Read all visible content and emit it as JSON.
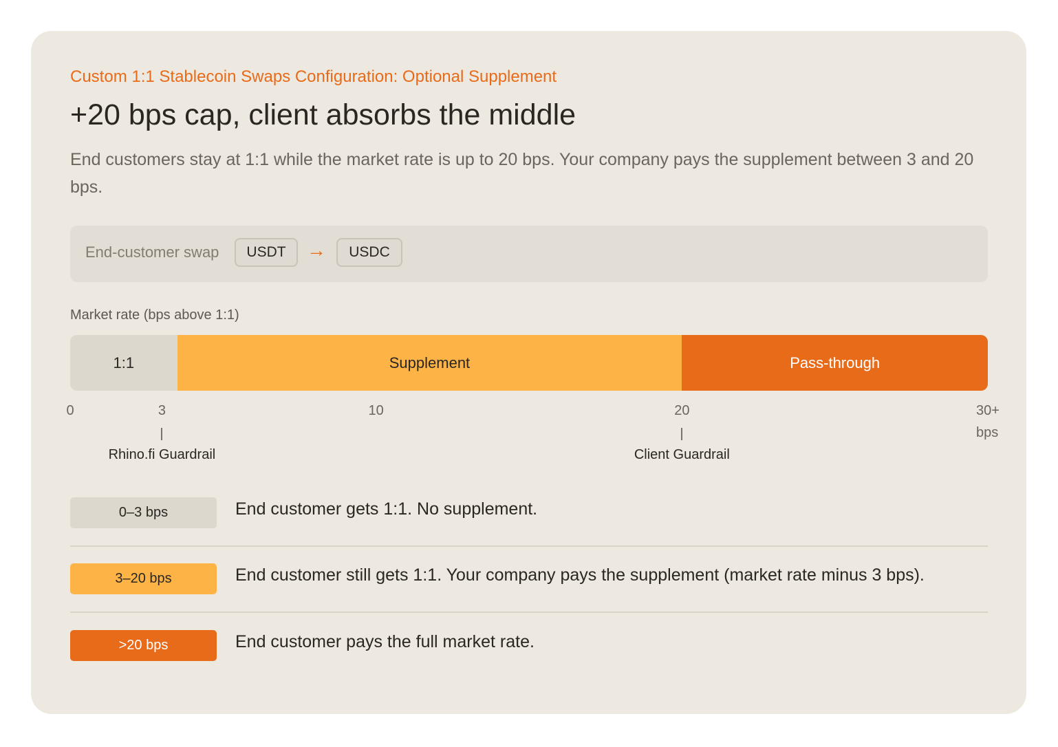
{
  "header": {
    "eyebrow": "Custom 1:1 Stablecoin Swaps Configuration: Optional Supplement",
    "title": "+20 bps cap, client absorbs the middle",
    "description": "End customers stay at 1:1 while the market rate is up to 20 bps. Your company pays the supplement between 3 and 20 bps."
  },
  "swap": {
    "label": "End-customer swap",
    "from_token": "USDT",
    "arrow": "→",
    "to_token": "USDC"
  },
  "chart_data": {
    "type": "bar",
    "axis_title": "Market rate (bps above 1:1)",
    "axis_range": [
      0,
      30
    ],
    "ticks": [
      {
        "value": 0,
        "label": "0"
      },
      {
        "value": 3,
        "label": "3"
      },
      {
        "value": 10,
        "label": "10"
      },
      {
        "value": 20,
        "label": "20"
      },
      {
        "value": 30,
        "label": "30+"
      }
    ],
    "unit_label": "bps",
    "segments": [
      {
        "label": "1:1",
        "start": 0,
        "end": 3.5,
        "color": "#ddd8ce",
        "text_color": "#2a2622"
      },
      {
        "label": "Supplement",
        "start": 3.5,
        "end": 20,
        "color": "#feb347",
        "text_color": "#2a2622"
      },
      {
        "label": "Pass-through",
        "start": 20,
        "end": 30,
        "color": "#e86b1a",
        "text_color": "#ffffff"
      }
    ],
    "guardrails": [
      {
        "value": 3,
        "label": "Rhino.fi Guardrail"
      },
      {
        "value": 20,
        "label": "Client Guardrail"
      }
    ]
  },
  "legend": [
    {
      "badge": "0–3 bps",
      "text": "End customer gets 1:1. No supplement.",
      "color": "#ddd8ce",
      "text_color": "#2a2622"
    },
    {
      "badge": "3–20 bps",
      "text": "End customer still gets 1:1. Your company pays the supplement (market rate minus 3 bps).",
      "color": "#feb347",
      "text_color": "#2a2622"
    },
    {
      "badge": ">20 bps",
      "text": "End customer pays the full market rate.",
      "color": "#e86b1a",
      "text_color": "#ffffff"
    }
  ]
}
